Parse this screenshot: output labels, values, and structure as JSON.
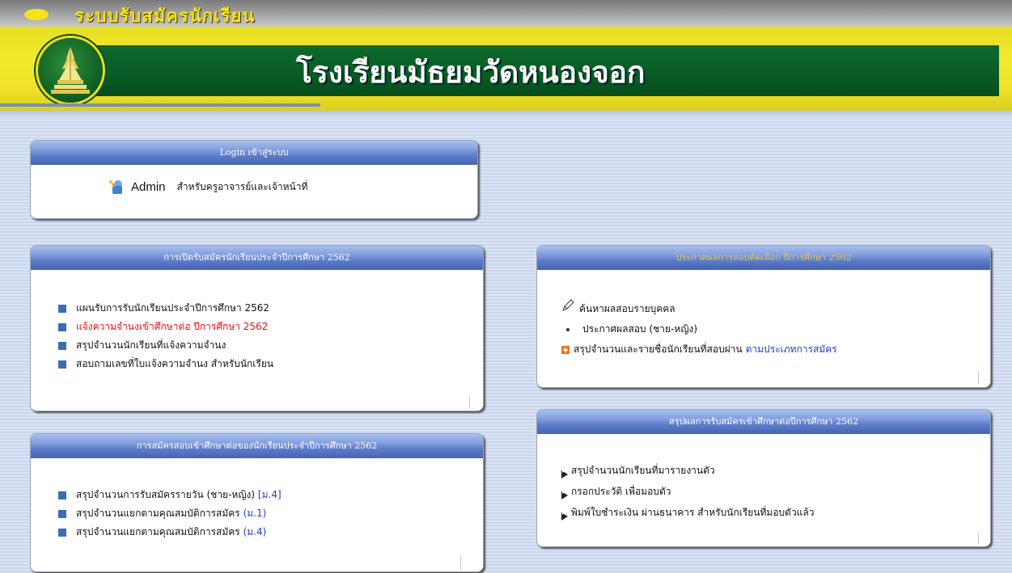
{
  "header": {
    "system_title": "ระบบรับสมัครนักเรียน",
    "school_name": "โรงเรียนมัธยมวัดหนองจอก"
  },
  "login_panel": {
    "title": "Login เข้าสู่ระบบ",
    "admin_label": "Admin",
    "admin_desc": "สำหรับครูอาจารย์และเจ้าหน้าที่"
  },
  "open_panel": {
    "title": "การเปิดรับสมัครนักเรียนประจำปีการศึกษา 2562",
    "items": [
      "แผนรับการรับนักเรียนประจำปีการศึกษา 2562",
      "แจ้งความจำนงเข้าศึกษาต่อ ปีการศึกษา 2562",
      "สรุปจำนวนนักเรียนที่แจ้งความจำนง",
      "สอบถามเลขที่ใบแจ้งความจำนง สำหรับนักเรียน"
    ]
  },
  "apply_panel": {
    "title": "การสมัครสอบเข้าศึกษาต่อของนักเรียนประจำปีการศึกษา 2562",
    "items": [
      {
        "text": "สรุปจำนวนการรับสมัครรายวัน (ชาย-หญิง) ",
        "tag": "[ม.4]"
      },
      {
        "text": "สรุปจำนวนแยกตามคุณสมบัติการสมัคร ",
        "tag": "(ม.1)"
      },
      {
        "text": "สรุปจำนวนแยกตามคุณสมบัติการสมัคร ",
        "tag": "(ม.4)"
      }
    ]
  },
  "result_panel": {
    "title": "ประกาศผลการสอบคัดเลือก ปีการศึกษา 2562",
    "search_label": "ค้นหาผลสอบรายบุคคล",
    "announce_label": "ประกาศผลสอบ (ชาย-หญิง)",
    "summary_text": "สรุปจำนวนและรายชื่อนักเรียนที่สอบผ่าน ",
    "summary_link": "ตามประเภทการสมัคร"
  },
  "summary_panel": {
    "title": "สรุปผลการรับสมัครเข้าศึกษาต่อปีการศึกษา 2562",
    "items": [
      "สรุปจำนวนนักเรียนที่มารายงานตัว",
      "กรอกประวัติ เพื่อมอบตัว",
      "พิมพ์ใบชำระเงิน ผ่านธนาคาร สำหรับนักเรียนที่มอบตัวแล้ว"
    ]
  },
  "colors": {
    "header_yellow": "#f4ea2b",
    "header_green": "#085b24",
    "panel_head_blue": "#5e7ecb",
    "link_red": "#ee1111",
    "link_blue": "#1f3fbf"
  }
}
